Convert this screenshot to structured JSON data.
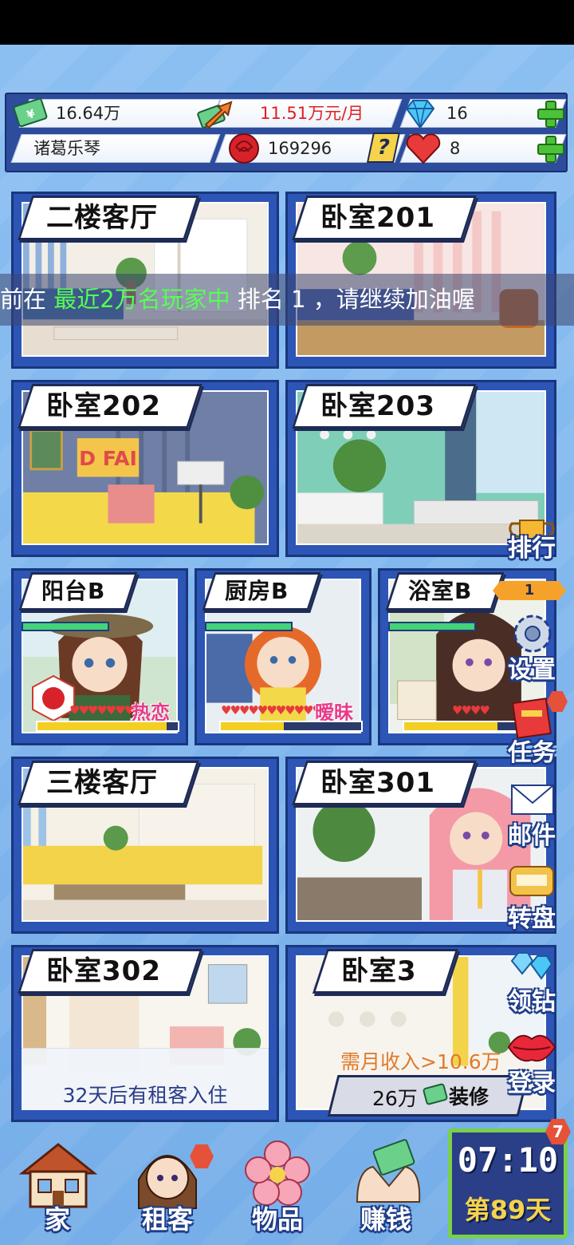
{
  "resources": {
    "money": "16.64万",
    "income": "11.51万元/月",
    "diamonds": "16",
    "player_name": "诸葛乐琴",
    "roses": "169296",
    "question": "?",
    "hearts": "8"
  },
  "banner": {
    "prefix": "前在 ",
    "highlight": "最近2万名玩家中",
    "suffix": " 排名 1 ，请继续加油喔"
  },
  "rooms": {
    "r1": "二楼客厅",
    "r2": "卧室201",
    "r3": "卧室202",
    "r4": "卧室203",
    "r5": "阳台B",
    "r6": "厨房B",
    "r7": "浴室B",
    "r8": "三楼客厅",
    "r9": "卧室301",
    "r10": "卧室302",
    "r11": "卧室3"
  },
  "tenants": {
    "balcony_status": "热恋",
    "balcony_fill": 0.92,
    "kitchen_status": "暧昧",
    "kitchen_fill": 0.45,
    "bath_fill": 0.8
  },
  "room302_notice": "32天后有租客入住",
  "room3_requirement": "需月收入>10.6万",
  "room3_cost": "26万",
  "room3_action": "装修",
  "side_menu": {
    "ranking": "排行",
    "ranking_value": "1",
    "settings": "设置",
    "tasks": "任务",
    "mail": "邮件",
    "wheel": "转盘",
    "diamonds": "领钻",
    "login": "登录"
  },
  "clock": {
    "time": "07:10",
    "day": "第89天",
    "badge": "7"
  },
  "bottom_nav": {
    "home": "家",
    "tenants": "租客",
    "items": "物品",
    "earn": "赚钱"
  },
  "colors": {
    "accent": "#2c55b5",
    "highlight_green": "#55ff55",
    "heart_red": "#e83a3a",
    "plus_green": "#4cc23a"
  }
}
